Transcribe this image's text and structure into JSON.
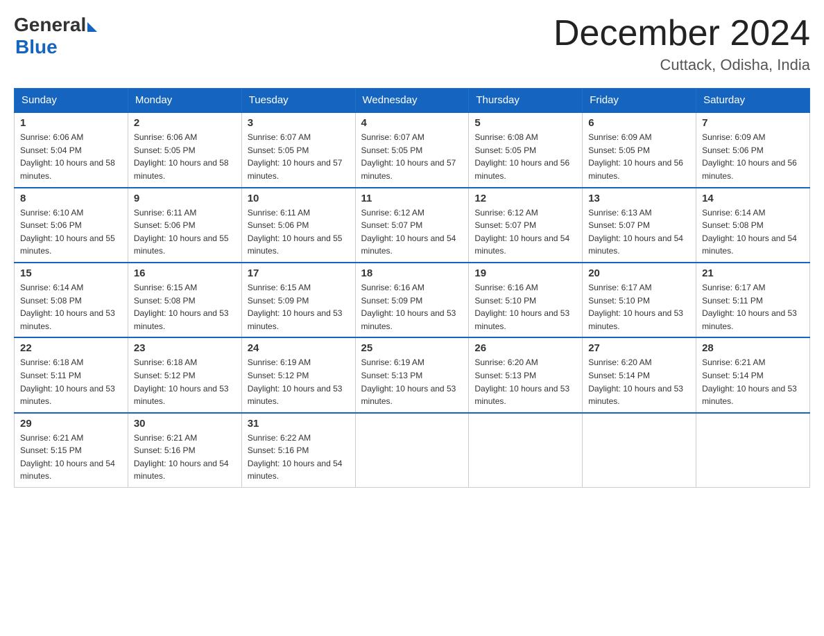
{
  "header": {
    "logo_general": "General",
    "logo_blue": "Blue",
    "title": "December 2024",
    "location": "Cuttack, Odisha, India"
  },
  "weekdays": [
    "Sunday",
    "Monday",
    "Tuesday",
    "Wednesday",
    "Thursday",
    "Friday",
    "Saturday"
  ],
  "weeks": [
    [
      {
        "day": "1",
        "sunrise": "6:06 AM",
        "sunset": "5:04 PM",
        "daylight": "10 hours and 58 minutes."
      },
      {
        "day": "2",
        "sunrise": "6:06 AM",
        "sunset": "5:05 PM",
        "daylight": "10 hours and 58 minutes."
      },
      {
        "day": "3",
        "sunrise": "6:07 AM",
        "sunset": "5:05 PM",
        "daylight": "10 hours and 57 minutes."
      },
      {
        "day": "4",
        "sunrise": "6:07 AM",
        "sunset": "5:05 PM",
        "daylight": "10 hours and 57 minutes."
      },
      {
        "day": "5",
        "sunrise": "6:08 AM",
        "sunset": "5:05 PM",
        "daylight": "10 hours and 56 minutes."
      },
      {
        "day": "6",
        "sunrise": "6:09 AM",
        "sunset": "5:05 PM",
        "daylight": "10 hours and 56 minutes."
      },
      {
        "day": "7",
        "sunrise": "6:09 AM",
        "sunset": "5:06 PM",
        "daylight": "10 hours and 56 minutes."
      }
    ],
    [
      {
        "day": "8",
        "sunrise": "6:10 AM",
        "sunset": "5:06 PM",
        "daylight": "10 hours and 55 minutes."
      },
      {
        "day": "9",
        "sunrise": "6:11 AM",
        "sunset": "5:06 PM",
        "daylight": "10 hours and 55 minutes."
      },
      {
        "day": "10",
        "sunrise": "6:11 AM",
        "sunset": "5:06 PM",
        "daylight": "10 hours and 55 minutes."
      },
      {
        "day": "11",
        "sunrise": "6:12 AM",
        "sunset": "5:07 PM",
        "daylight": "10 hours and 54 minutes."
      },
      {
        "day": "12",
        "sunrise": "6:12 AM",
        "sunset": "5:07 PM",
        "daylight": "10 hours and 54 minutes."
      },
      {
        "day": "13",
        "sunrise": "6:13 AM",
        "sunset": "5:07 PM",
        "daylight": "10 hours and 54 minutes."
      },
      {
        "day": "14",
        "sunrise": "6:14 AM",
        "sunset": "5:08 PM",
        "daylight": "10 hours and 54 minutes."
      }
    ],
    [
      {
        "day": "15",
        "sunrise": "6:14 AM",
        "sunset": "5:08 PM",
        "daylight": "10 hours and 53 minutes."
      },
      {
        "day": "16",
        "sunrise": "6:15 AM",
        "sunset": "5:08 PM",
        "daylight": "10 hours and 53 minutes."
      },
      {
        "day": "17",
        "sunrise": "6:15 AM",
        "sunset": "5:09 PM",
        "daylight": "10 hours and 53 minutes."
      },
      {
        "day": "18",
        "sunrise": "6:16 AM",
        "sunset": "5:09 PM",
        "daylight": "10 hours and 53 minutes."
      },
      {
        "day": "19",
        "sunrise": "6:16 AM",
        "sunset": "5:10 PM",
        "daylight": "10 hours and 53 minutes."
      },
      {
        "day": "20",
        "sunrise": "6:17 AM",
        "sunset": "5:10 PM",
        "daylight": "10 hours and 53 minutes."
      },
      {
        "day": "21",
        "sunrise": "6:17 AM",
        "sunset": "5:11 PM",
        "daylight": "10 hours and 53 minutes."
      }
    ],
    [
      {
        "day": "22",
        "sunrise": "6:18 AM",
        "sunset": "5:11 PM",
        "daylight": "10 hours and 53 minutes."
      },
      {
        "day": "23",
        "sunrise": "6:18 AM",
        "sunset": "5:12 PM",
        "daylight": "10 hours and 53 minutes."
      },
      {
        "day": "24",
        "sunrise": "6:19 AM",
        "sunset": "5:12 PM",
        "daylight": "10 hours and 53 minutes."
      },
      {
        "day": "25",
        "sunrise": "6:19 AM",
        "sunset": "5:13 PM",
        "daylight": "10 hours and 53 minutes."
      },
      {
        "day": "26",
        "sunrise": "6:20 AM",
        "sunset": "5:13 PM",
        "daylight": "10 hours and 53 minutes."
      },
      {
        "day": "27",
        "sunrise": "6:20 AM",
        "sunset": "5:14 PM",
        "daylight": "10 hours and 53 minutes."
      },
      {
        "day": "28",
        "sunrise": "6:21 AM",
        "sunset": "5:14 PM",
        "daylight": "10 hours and 53 minutes."
      }
    ],
    [
      {
        "day": "29",
        "sunrise": "6:21 AM",
        "sunset": "5:15 PM",
        "daylight": "10 hours and 54 minutes."
      },
      {
        "day": "30",
        "sunrise": "6:21 AM",
        "sunset": "5:16 PM",
        "daylight": "10 hours and 54 minutes."
      },
      {
        "day": "31",
        "sunrise": "6:22 AM",
        "sunset": "5:16 PM",
        "daylight": "10 hours and 54 minutes."
      },
      null,
      null,
      null,
      null
    ]
  ]
}
